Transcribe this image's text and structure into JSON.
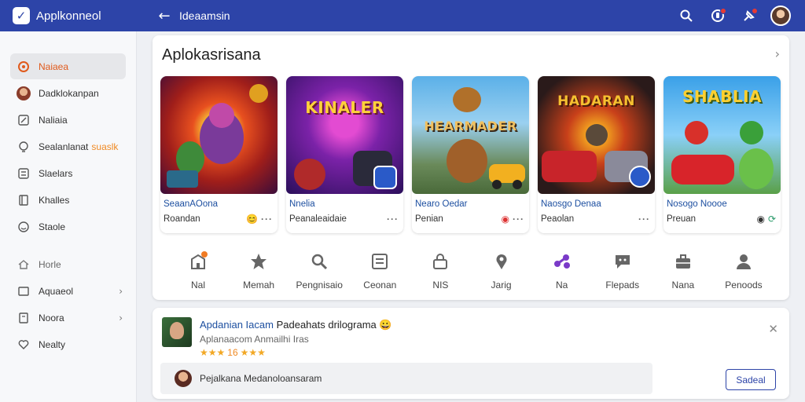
{
  "topbar": {
    "app_name": "Applkonneol",
    "back_icon": "back-arrow-icon",
    "title": "Ideaamsin",
    "icons": [
      "search-icon",
      "notification-icon",
      "alert-icon",
      "user-avatar"
    ]
  },
  "sidebar": {
    "items": [
      {
        "label": "Naiaea",
        "icon": "target-icon",
        "active": true
      },
      {
        "label": "Dadklokanpan",
        "icon": "profile-avatar"
      },
      {
        "label": "Naliaia",
        "icon": "edit-icon"
      },
      {
        "label": "Sealanlanat",
        "suffix": "suaslk",
        "icon": "bulb-icon"
      },
      {
        "label": "Slaelars",
        "icon": "list-icon"
      },
      {
        "label": "Khalles",
        "icon": "book-icon"
      },
      {
        "label": "Staole",
        "icon": "smile-icon"
      },
      {
        "label": "Horle",
        "icon": "home-icon"
      },
      {
        "label": "Aquaeol",
        "icon": "box-icon"
      },
      {
        "label": "Noora",
        "icon": "doc-icon"
      },
      {
        "label": "Nealty",
        "icon": "heart-icon"
      }
    ]
  },
  "main": {
    "section_title": "Aplokasrisana",
    "apps": [
      {
        "name": "SeaanAOona",
        "publisher": "Roandan",
        "image_text": ""
      },
      {
        "name": "Nnelia",
        "publisher": "Peanaleaidaie",
        "image_text": "KINALER"
      },
      {
        "name": "Nearo Oedar",
        "publisher": "Penian",
        "image_text": "HEARMADER"
      },
      {
        "name": "Naosgo Denaa",
        "publisher": "Peaolan",
        "image_text": "HADARAN"
      },
      {
        "name": "Nosogo Noooe",
        "publisher": "Preuan",
        "image_text": "SHABLIA"
      }
    ],
    "categories": [
      {
        "label": "Nal",
        "icon": "shop-icon"
      },
      {
        "label": "Memah",
        "icon": "star-icon"
      },
      {
        "label": "Pengnisaio",
        "icon": "tools-icon"
      },
      {
        "label": "Ceonan",
        "icon": "grid-list-icon"
      },
      {
        "label": "NIS",
        "icon": "lock-icon"
      },
      {
        "label": "Jarig",
        "icon": "location-pin-icon"
      },
      {
        "label": "Na",
        "icon": "network-icon"
      },
      {
        "label": "Flepads",
        "icon": "chat-icon"
      },
      {
        "label": "Nana",
        "icon": "briefcase-icon"
      },
      {
        "label": "Penoods",
        "icon": "person-icon"
      }
    ]
  },
  "recommendation": {
    "title_highlight": "Apdanian Iacam",
    "title_rest": "Padeahats drilograma",
    "emoji": "😀",
    "subtitle": "Aplanaacom Anmailhi Iras",
    "rating_number": "16",
    "comment_placeholder": "Pejalkana Medanoloansaram",
    "send_label": "Sadeal"
  },
  "colors": {
    "topbar": "#2d44a8",
    "accent_orange": "#f08a24",
    "link_blue": "#1d4fa0"
  }
}
